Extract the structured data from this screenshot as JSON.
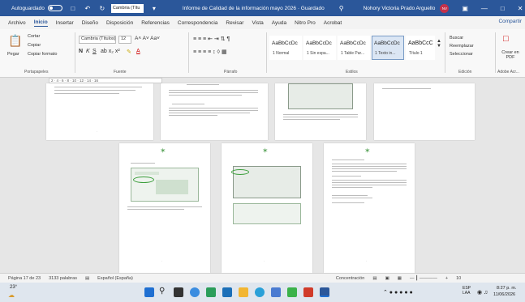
{
  "titlebar": {
    "autosave": "Autoguardado",
    "font_value": "Cambria (Títu",
    "doc_title": "Informe de Calidad de la información mayo 2026 · Guardado",
    "user_name": "Nohory Victoria Prado Arguello",
    "avatar_initials": "NV"
  },
  "menu": {
    "items": [
      "Archivo",
      "Inicio",
      "Insertar",
      "Diseño",
      "Disposición",
      "Referencias",
      "Correspondencia",
      "Revisar",
      "Vista",
      "Ayuda",
      "Nitro Pro",
      "Acrobat"
    ],
    "share": "Compartir"
  },
  "ribbon": {
    "clipboard": {
      "paste": "Pegar",
      "cut": "Cortar",
      "copy": "Copiar",
      "format_painter": "Copiar formato",
      "label": "Portapapeles"
    },
    "font": {
      "name": "Cambria (Títulos)",
      "size": "12",
      "label": "Fuente"
    },
    "paragraph": {
      "label": "Párrafo"
    },
    "styles": {
      "label": "Estilos",
      "items": [
        {
          "sample": "AaBbCcDc",
          "name": "1 Normal"
        },
        {
          "sample": "AaBbCcDc",
          "name": "1 Sin espa..."
        },
        {
          "sample": "AaBbCcDc",
          "name": "1 Table Par..."
        },
        {
          "sample": "AaBbCcDc",
          "name": "1 Texto in..."
        },
        {
          "sample": "AaBbCcC",
          "name": "Título 1"
        }
      ]
    },
    "editing": {
      "find": "Buscar",
      "replace": "Reemplazar",
      "select": "Seleccionar",
      "label": "Edición"
    },
    "pdf": {
      "create": "Crear en PDF",
      "label": "Adobe Acr..."
    }
  },
  "ruler": {
    "marks": "2 · 4 · 6 · 8 · 10 · 12 · 14 · 16"
  },
  "status": {
    "page": "Página 17 de 23",
    "words": "3133 palabras",
    "language": "Español (España)",
    "focus": "Concentración",
    "zoom_plus": "+",
    "zoom_value": "10"
  },
  "taskbar": {
    "weather": "23°",
    "lang": "ESP LAA",
    "time": "8:27 p. m.",
    "date": "11/06/2026"
  },
  "colors": {
    "titlebar": "#2b579a",
    "accent": "#2b579a"
  }
}
